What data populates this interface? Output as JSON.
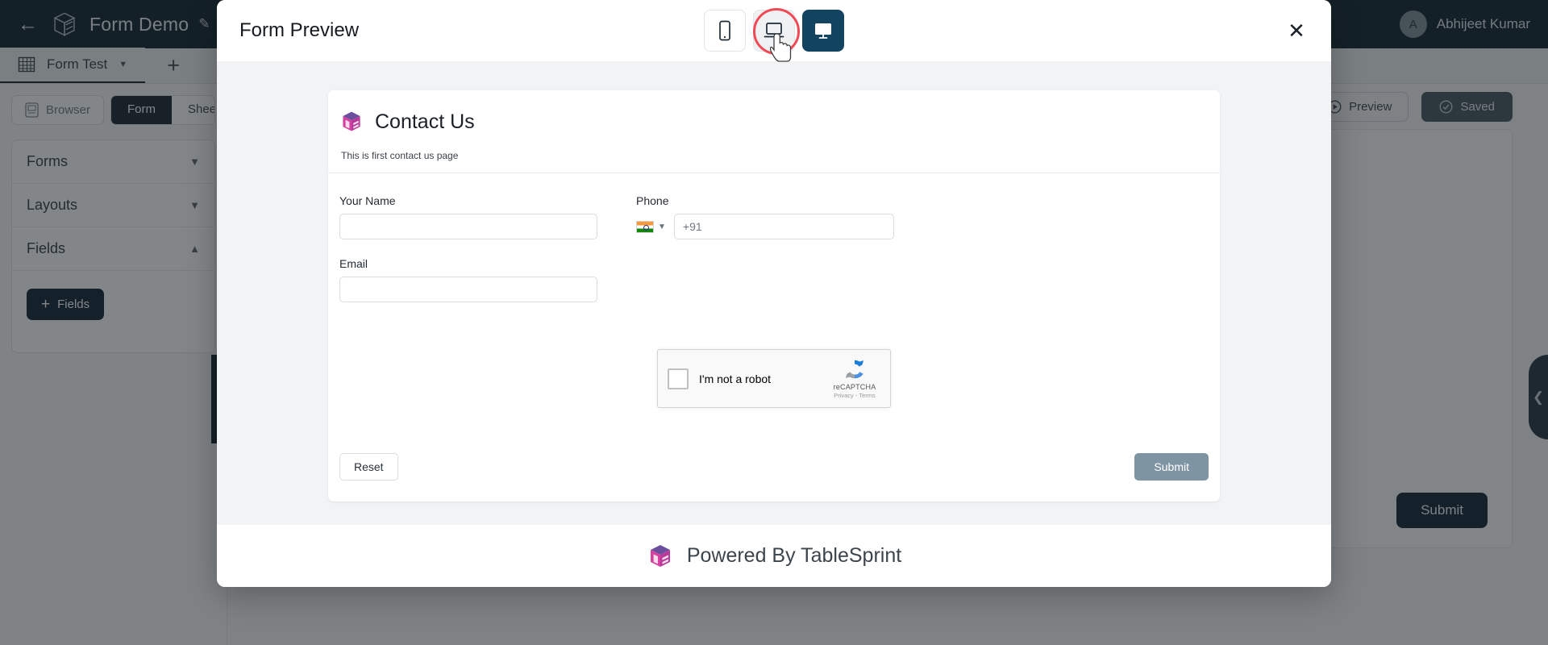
{
  "topbar": {
    "back_icon": "arrow-left-icon",
    "logo_icon": "cube-logo-icon",
    "app_title": "Form Demo",
    "edit_icon": "pencil-icon",
    "avatar_initial": "A",
    "user_name": "Abhijeet Kumar"
  },
  "tabbar": {
    "sheet_icon": "table-grid-icon",
    "sheet_name": "Form Test",
    "sheet_caret": "chevron-down-icon",
    "add_tab": "+"
  },
  "sidebar": {
    "browser_label": "Browser",
    "browser_icon": "browser-panel-icon",
    "segments": [
      {
        "label": "Form",
        "active": true
      },
      {
        "label": "Sheet",
        "active": false
      }
    ],
    "accordions": [
      {
        "label": "Forms",
        "expanded": false,
        "chevron": "chevron-down-icon"
      },
      {
        "label": "Layouts",
        "expanded": false,
        "chevron": "chevron-down-icon"
      },
      {
        "label": "Fields",
        "expanded": true,
        "chevron": "chevron-up-icon"
      }
    ],
    "add_fields_button": "Fields",
    "add_fields_plus": "+",
    "collapse_handle": "sidebar-collapse-handle"
  },
  "canvas": {
    "preview_button": "Preview",
    "preview_icon": "play-circle-icon",
    "saved_button": "Saved",
    "saved_icon": "check-circle-icon",
    "submit_button": "Submit",
    "right_handle_icon": "chevron-left-icon"
  },
  "modal": {
    "title": "Form Preview",
    "close_icon": "close-x-icon",
    "devices": [
      {
        "name": "mobile",
        "icon": "mobile-phone-icon",
        "state": "default"
      },
      {
        "name": "tablet",
        "icon": "laptop-icon",
        "state": "hovered"
      },
      {
        "name": "desktop",
        "icon": "desktop-monitor-icon",
        "state": "active"
      }
    ],
    "form": {
      "logo_icon": "cube-logo-icon",
      "heading": "Contact Us",
      "subtitle": "This is first contact us page",
      "fields": [
        {
          "label": "Your Name",
          "value": "",
          "placeholder": "",
          "type": "text"
        },
        {
          "label": "Phone",
          "value": "",
          "placeholder": "+91",
          "type": "phone",
          "country_flag": "india-flag-icon",
          "flag_caret": "chevron-down-icon"
        },
        {
          "label": "Email",
          "value": "",
          "placeholder": "",
          "type": "text"
        }
      ],
      "captcha": {
        "checkbox_label": "I'm not a robot",
        "brand": "reCAPTCHA",
        "links": "Privacy - Terms",
        "logo_icon": "recaptcha-logo-icon"
      },
      "reset_button": "Reset",
      "submit_button": "Submit"
    },
    "footer": {
      "logo_icon": "cube-logo-icon",
      "text": "Powered By TableSprint"
    }
  },
  "colors": {
    "topbar_bg": "#0b1d2a",
    "accent_dark": "#15212b",
    "device_active": "#12435f",
    "hover_ring": "#ef4a56",
    "submit_muted": "#7f94a2",
    "logo_purple": "#6b4e9e",
    "logo_pink": "#d6409f"
  }
}
